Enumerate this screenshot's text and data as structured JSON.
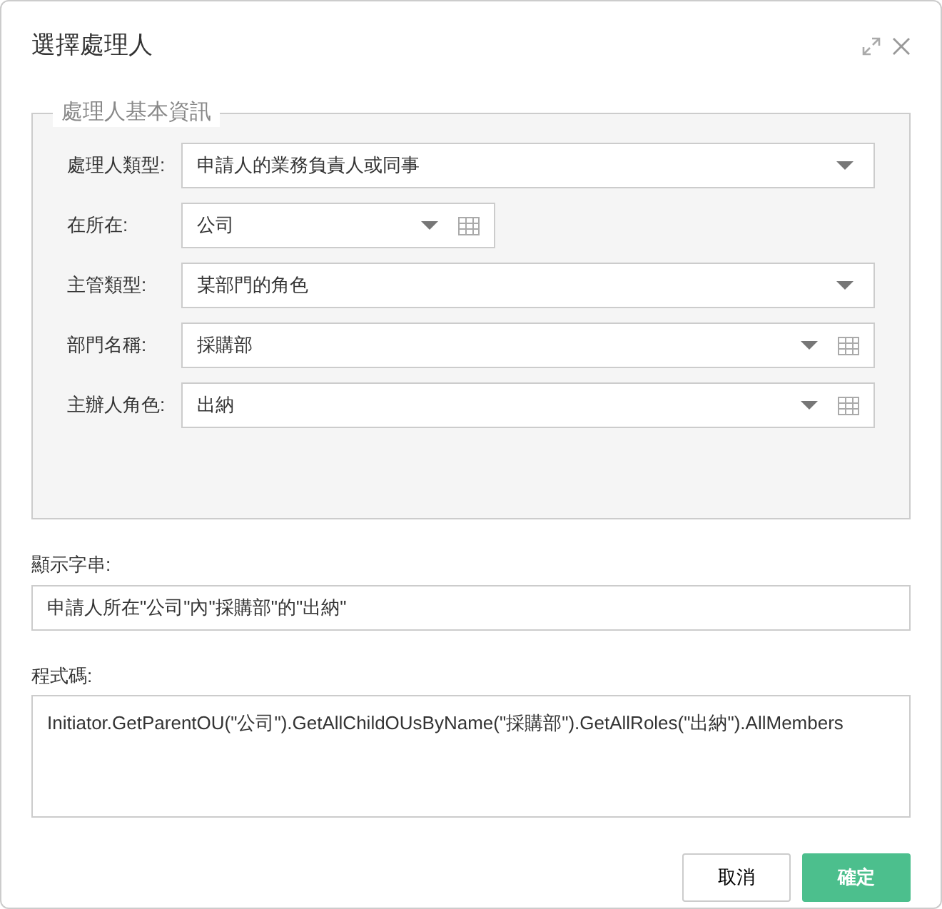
{
  "dialog": {
    "title": "選擇處理人"
  },
  "fieldset": {
    "legend": "處理人基本資訊",
    "fields": [
      {
        "label": "處理人類型:",
        "value": "申請人的業務負責人或同事",
        "kind": "select"
      },
      {
        "label": "在所在:",
        "value": "公司",
        "kind": "short-picker"
      },
      {
        "label": "主管類型:",
        "value": "某部門的角色",
        "kind": "select"
      },
      {
        "label": "部門名稱:",
        "value": "採購部",
        "kind": "picker"
      },
      {
        "label": "主辦人角色:",
        "value": "出納",
        "kind": "picker"
      }
    ]
  },
  "display_string": {
    "label": "顯示字串:",
    "value": "申請人所在\"公司\"內\"採購部\"的\"出納\""
  },
  "code": {
    "label": "程式碼:",
    "value": "Initiator.GetParentOU(\"公司\").GetAllChildOUsByName(\"採購部\").GetAllRoles(\"出納\").AllMembers"
  },
  "buttons": [
    {
      "label": "取消",
      "kind": "secondary"
    },
    {
      "label": "確定",
      "kind": "primary"
    }
  ]
}
